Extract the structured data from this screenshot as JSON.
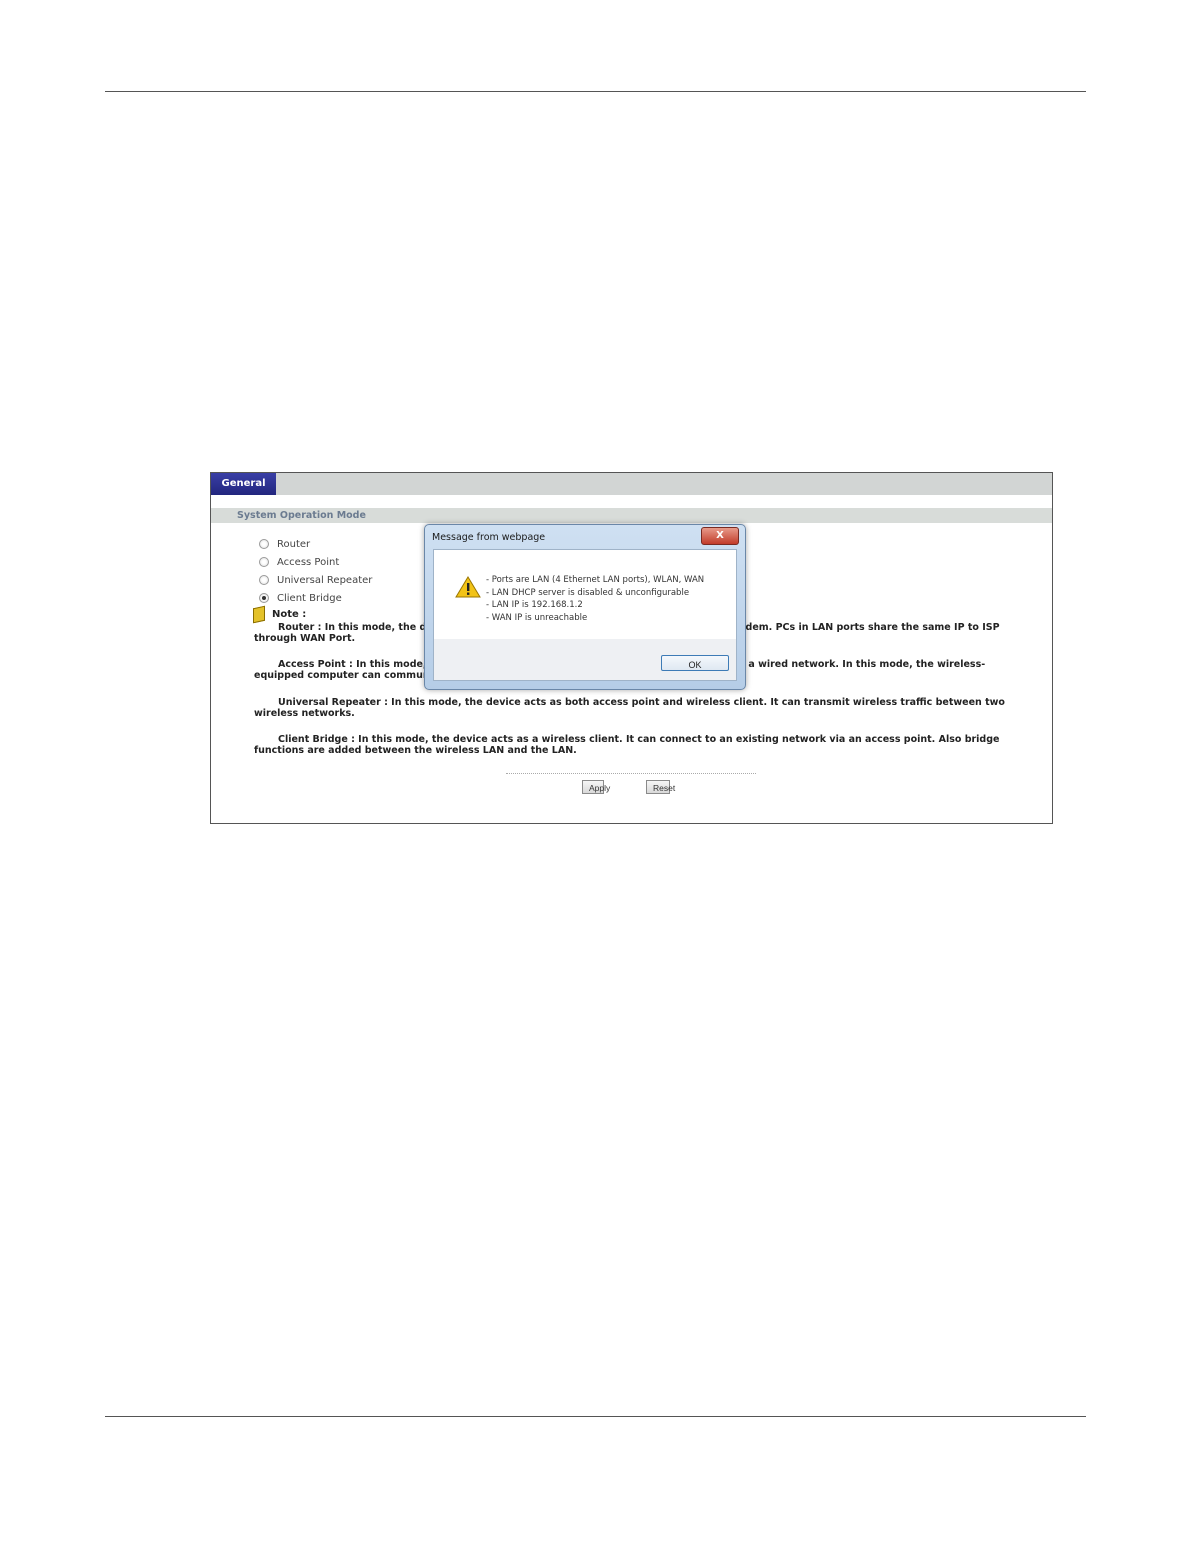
{
  "page": {
    "tab_label": "General",
    "section_title": "System Operation Mode",
    "note_label": "Note :"
  },
  "options": [
    {
      "label": "Router",
      "checked": false
    },
    {
      "label": "Access Point",
      "checked": false
    },
    {
      "label": "Universal Repeater",
      "checked": false
    },
    {
      "label": "Client Bridge",
      "checked": true
    }
  ],
  "descriptions": {
    "router": "Router : In this mode, the device is supposed to connect to internet via ADSL/Cable Modem. PCs in LAN ports share the same IP to ISP through WAN Port.",
    "access_point": "Access Point : In this mode, the device enables a wireless station to communicate with a wired network. In this mode, the wireless-equipped computer can communicate with a wired network.",
    "universal_repeater": "Universal Repeater : In this mode, the device acts as both access point and wireless client. It can transmit wireless traffic between two wireless networks.",
    "client_bridge": "Client Bridge : In this mode, the device acts as a wireless client. It can connect to an existing network via an access point. Also bridge functions are added between the wireless LAN and the LAN."
  },
  "buttons": {
    "apply": "Apply",
    "reset": "Reset"
  },
  "dialog": {
    "title": "Message from webpage",
    "close": "X",
    "icon": "warning-icon",
    "lines": [
      "- Ports are LAN (4 Ethernet LAN ports), WLAN, WAN",
      "- LAN DHCP server is disabled & unconfigurable",
      "- LAN IP is 192.168.1.2",
      "- WAN IP is unreachable"
    ],
    "ok": "OK"
  }
}
